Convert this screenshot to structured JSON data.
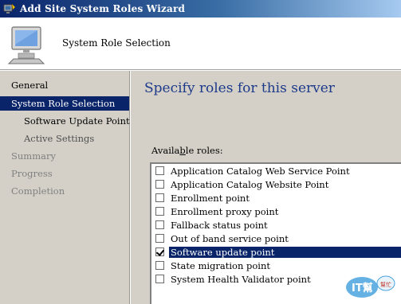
{
  "window": {
    "title": "Add Site System Roles Wizard",
    "icon": "wizard-app-icon"
  },
  "header": {
    "title": "System Role Selection",
    "icon": "computer-icon"
  },
  "sidebar": {
    "items": [
      {
        "label": "General",
        "state": "normal"
      },
      {
        "label": "System Role Selection",
        "state": "selected"
      },
      {
        "label": "Software Update Point",
        "state": "sub"
      },
      {
        "label": "Active Settings",
        "state": "sub-disabled"
      },
      {
        "label": "Summary",
        "state": "disabled"
      },
      {
        "label": "Progress",
        "state": "disabled"
      },
      {
        "label": "Completion",
        "state": "disabled"
      }
    ]
  },
  "main": {
    "heading": "Specify roles for this server",
    "available_label_pre": "Availa",
    "available_label_accel": "b",
    "available_label_post": "le roles:",
    "roles": [
      {
        "label": "Application Catalog Web Service Point",
        "checked": false
      },
      {
        "label": "Application Catalog Website Point",
        "checked": false
      },
      {
        "label": "Enrollment point",
        "checked": false
      },
      {
        "label": "Enrollment proxy point",
        "checked": false
      },
      {
        "label": "Fallback status point",
        "checked": false
      },
      {
        "label": "Out of band service point",
        "checked": false
      },
      {
        "label": "Software update point",
        "checked": true,
        "selected": true
      },
      {
        "label": "State migration point",
        "checked": false
      },
      {
        "label": "System Health Validator point",
        "checked": false
      }
    ]
  },
  "watermark": {
    "text": "IT幫",
    "sub": "幫忙"
  },
  "colors": {
    "selection": "#0a246a",
    "heading": "#1c3a8a",
    "panel": "#d4d0c8"
  }
}
